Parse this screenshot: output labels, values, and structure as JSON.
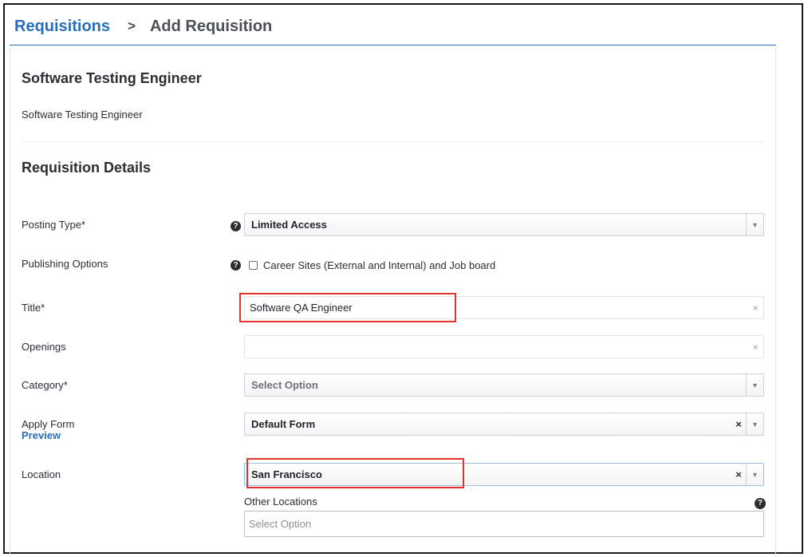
{
  "breadcrumb": {
    "parent": "Requisitions",
    "separator": ">",
    "current": "Add Requisition"
  },
  "job": {
    "heading": "Software Testing Engineer",
    "subtitle": "Software Testing Engineer"
  },
  "section": {
    "heading": "Requisition Details"
  },
  "form": {
    "posting_type": {
      "label": "Posting Type*",
      "value": "Limited Access",
      "help_icon": "question-circle-icon"
    },
    "publishing_options": {
      "label": "Publishing Options",
      "checkbox_label": "Career Sites (External and Internal) and Job board",
      "checked": false
    },
    "title": {
      "label": "Title*",
      "value": "Software QA Engineer"
    },
    "openings": {
      "label": "Openings",
      "value": ""
    },
    "category": {
      "label": "Category*",
      "placeholder": "Select Option"
    },
    "apply_form": {
      "label": "Apply Form",
      "preview_label": "Preview",
      "value": "Default Form"
    },
    "location": {
      "label": "Location",
      "value": "San Francisco"
    },
    "other_locations": {
      "label": "Other Locations",
      "placeholder": "Select Option"
    }
  },
  "icons": {
    "clear": "×",
    "dropdown": "▼",
    "help": "?"
  },
  "colors": {
    "link": "#2a6ebb",
    "highlight": "#e5322d",
    "text": "#2b2f33"
  }
}
